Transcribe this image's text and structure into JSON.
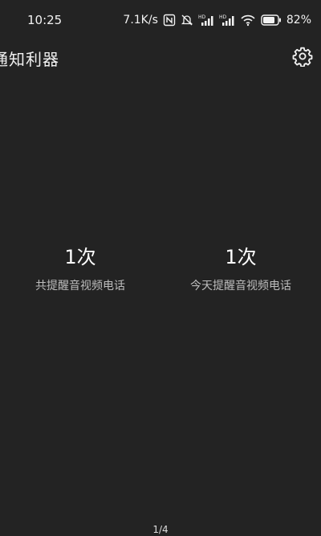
{
  "status_bar": {
    "time": "10:25",
    "net_speed": "7.1K/s",
    "battery_pct": "82%",
    "icons": [
      "nfc-icon",
      "mute-icon",
      "signal-hd-1-icon",
      "signal-hd-2-icon",
      "wifi-icon",
      "battery-icon"
    ]
  },
  "app_bar": {
    "title": "通知利器",
    "settings_icon": "gear-icon"
  },
  "stats": [
    {
      "value": "1次",
      "label": "共提醒音视频电话"
    },
    {
      "value": "1次",
      "label": "今天提醒音视频电话"
    }
  ],
  "pager": {
    "indicator": "1/4"
  },
  "colors": {
    "background": "#232323",
    "text": "#ffffff",
    "label": "#bdbdbd"
  }
}
